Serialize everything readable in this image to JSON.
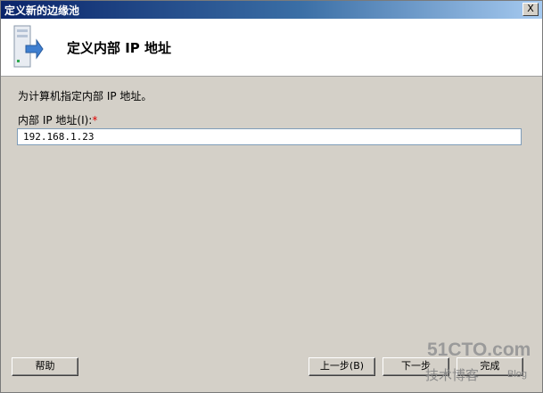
{
  "window": {
    "title": "定义新的边缘池",
    "close_label": "X"
  },
  "header": {
    "title": "定义内部 IP 地址",
    "icon": "server-arrow-icon"
  },
  "form": {
    "instruction": "为计算机指定内部 IP 地址。",
    "label": "内部 IP 地址(I):",
    "required_marker": "*",
    "ip_value": "192.168.1.23"
  },
  "buttons": {
    "help": "帮助",
    "back": "上一步(B)",
    "next": "下一步",
    "finish": "完成"
  },
  "watermark": {
    "main": "51CTO.com",
    "sub": "技术博客",
    "blog": "Blog"
  },
  "colors": {
    "title_gradient_start": "#0a246a",
    "dialog_bg": "#d4d0c8",
    "required": "#e00000"
  }
}
